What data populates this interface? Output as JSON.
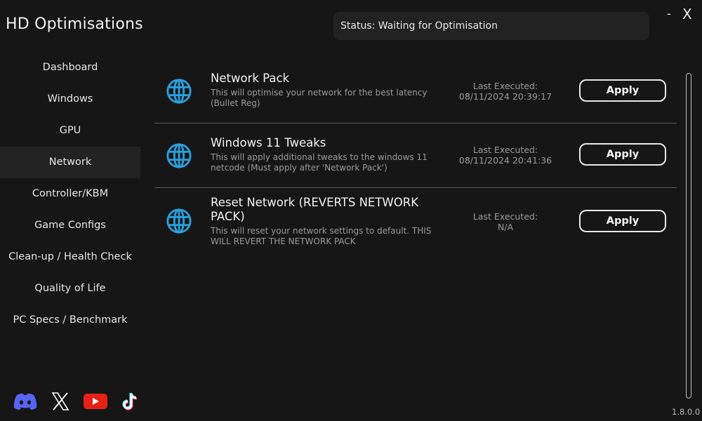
{
  "app": {
    "title": "HD Optimisations",
    "version": "1.8.0.0"
  },
  "window": {
    "minimize_label": "-",
    "close_label": "X"
  },
  "status": {
    "text": "Status: Waiting for Optimisation"
  },
  "sidebar": {
    "active": "Network",
    "items": [
      {
        "label": "Dashboard"
      },
      {
        "label": "Windows"
      },
      {
        "label": "GPU"
      },
      {
        "label": "Network"
      },
      {
        "label": "Controller/KBM"
      },
      {
        "label": "Game Configs"
      },
      {
        "label": "Clean-up / Health Check"
      },
      {
        "label": "Quality of Life"
      },
      {
        "label": "PC Specs / Benchmark"
      }
    ]
  },
  "socials": [
    {
      "name": "discord-icon",
      "color": "#5865f2"
    },
    {
      "name": "x-icon",
      "color": "#ffffff"
    },
    {
      "name": "youtube-icon",
      "color": "#e62117"
    },
    {
      "name": "tiktok-icon",
      "color": "#ffffff"
    }
  ],
  "colors": {
    "accent": "#2aa0dc",
    "background": "#161616",
    "panel": "#222222"
  },
  "tweaks": [
    {
      "title": "Network Pack",
      "description": "This will optimise your network for the best latency (Bullet Reg)",
      "last_executed_label": "Last Executed:",
      "last_executed": "08/11/2024 20:39:17",
      "button": "Apply",
      "icon": "globe-icon"
    },
    {
      "title": "Windows 11 Tweaks",
      "description": "This will apply additional tweaks to the windows 11 netcode (Must apply after 'Network Pack')",
      "last_executed_label": "Last Executed:",
      "last_executed": "08/11/2024 20:41:36",
      "button": "Apply",
      "icon": "globe-icon"
    },
    {
      "title": "Reset Network (REVERTS NETWORK PACK)",
      "description": "This will reset your network settings to default. THIS WILL REVERT THE NETWORK PACK",
      "last_executed_label": "Last Executed:",
      "last_executed": "N/A",
      "button": "Apply",
      "icon": "globe-icon"
    }
  ]
}
